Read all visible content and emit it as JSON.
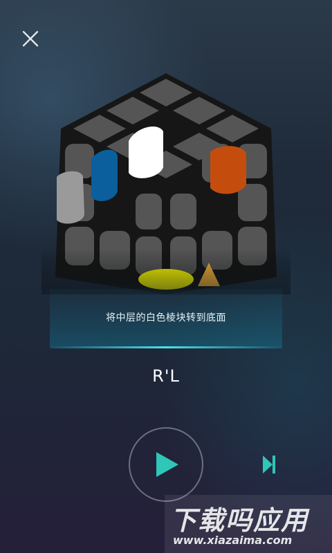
{
  "header": {
    "close_icon": "close-icon"
  },
  "cube": {
    "visible_sticker_colors": {
      "top_left_face_left": "#9a9a9a",
      "top_left_face_mid": "#0a5f9c",
      "top_face_center": "#ffffff",
      "right_face_top": "#c44d0e",
      "bottom_front": "#ffff00"
    },
    "pointer_arrow_color": "#f2b13a",
    "tile_color": "#555555"
  },
  "instruction": {
    "text": "将中层的白色棱块转到底面"
  },
  "move": {
    "notation": "R'L"
  },
  "controls": {
    "play_icon": "play-icon",
    "next_icon": "skip-next-icon",
    "accent": "#2ec7b8"
  },
  "watermark": {
    "title": "下载吗应用",
    "url": "www.xiazaima.com"
  }
}
